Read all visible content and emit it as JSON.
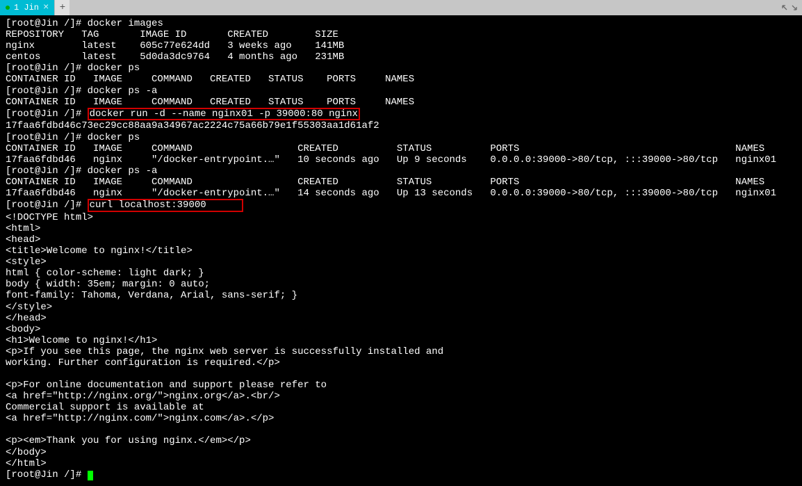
{
  "tab": {
    "label": "1 Jin",
    "close": "×",
    "add": "+"
  },
  "prompt": {
    "userhost": "[root@Jin /]# "
  },
  "lines": {
    "l1_cmd": "docker images",
    "l2": "REPOSITORY   TAG       IMAGE ID       CREATED        SIZE",
    "l3": "nginx        latest    605c77e624dd   3 weeks ago    141MB",
    "l4": "centos       latest    5d0da3dc9764   4 months ago   231MB",
    "l5_cmd": "docker ps",
    "l6": "CONTAINER ID   IMAGE     COMMAND   CREATED   STATUS    PORTS     NAMES",
    "l7_cmd": "docker ps -a",
    "l8": "CONTAINER ID   IMAGE     COMMAND   CREATED   STATUS    PORTS     NAMES",
    "l9_cmd_hl": "docker run -d --name nginx01 -p 39000:80 nginx",
    "l10": "17faa6fdbd46c73ec29cc88aa9a34967ac2224c75a66b79e1f55303aa1d61af2",
    "l11_cmd": "docker ps",
    "l12": "CONTAINER ID   IMAGE     COMMAND                  CREATED          STATUS          PORTS                                     NAMES",
    "l13": "17faa6fdbd46   nginx     \"/docker-entrypoint.…\"   10 seconds ago   Up 9 seconds    0.0.0.0:39000->80/tcp, :::39000->80/tcp   nginx01",
    "l14_cmd": "docker ps -a",
    "l15": "CONTAINER ID   IMAGE     COMMAND                  CREATED          STATUS          PORTS                                     NAMES",
    "l16": "17faa6fdbd46   nginx     \"/docker-entrypoint.…\"   14 seconds ago   Up 13 seconds   0.0.0.0:39000->80/tcp, :::39000->80/tcp   nginx01",
    "l17_cmd_hl": "curl localhost:39000",
    "o1": "<!DOCTYPE html>",
    "o2": "<html>",
    "o3": "<head>",
    "o4": "<title>Welcome to nginx!</title>",
    "o5": "<style>",
    "o6": "html { color-scheme: light dark; }",
    "o7": "body { width: 35em; margin: 0 auto;",
    "o8": "font-family: Tahoma, Verdana, Arial, sans-serif; }",
    "o9": "</style>",
    "o10": "</head>",
    "o11": "<body>",
    "o12": "<h1>Welcome to nginx!</h1>",
    "o13": "<p>If you see this page, the nginx web server is successfully installed and",
    "o14": "working. Further configuration is required.</p>",
    "o15": "",
    "o16": "<p>For online documentation and support please refer to",
    "o17": "<a href=\"http://nginx.org/\">nginx.org</a>.<br/>",
    "o18": "Commercial support is available at",
    "o19": "<a href=\"http://nginx.com/\">nginx.com</a>.</p>",
    "o20": "",
    "o21": "<p><em>Thank you for using nginx.</em></p>",
    "o22": "</body>",
    "o23": "</html>"
  }
}
